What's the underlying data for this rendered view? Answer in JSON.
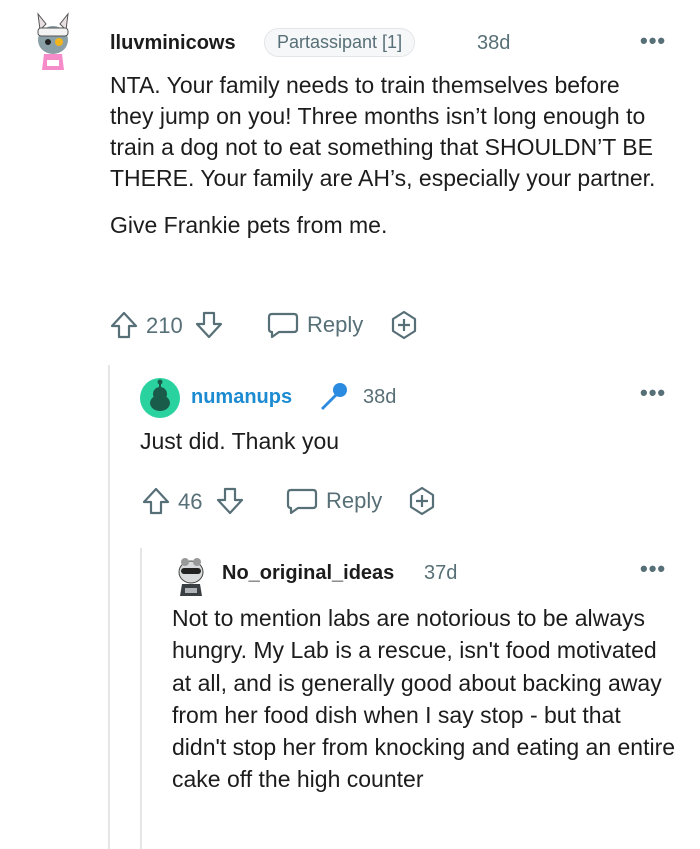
{
  "comments": [
    {
      "username": "lluvminicows",
      "flair": "Partassipant [1]",
      "age": "38d",
      "paragraphs": [
        "NTA. Your family needs to train themselves before they jump on you! Three months isn’t long enough to train a dog not to eat something that SHOULDN’T BE THERE. Your family are AH’s, especially your partner.",
        "Give Frankie pets from me."
      ],
      "score": "210",
      "reply_label": "Reply"
    },
    {
      "username": "numanups",
      "age": "38d",
      "paragraphs": [
        "Just did. Thank you"
      ],
      "score": "46",
      "reply_label": "Reply"
    },
    {
      "username": "No_original_ideas",
      "age": "37d",
      "paragraphs": [
        "Not to mention labs are notorious to be always hungry. My Lab is a rescue, isn't food motivated at all, and is generally good about backing away from her food dish when I say stop - but that didn't stop her from knocking and eating an entire cake off the high counter"
      ]
    }
  ],
  "more_glyph": "•••",
  "colors": {
    "username_op": "#1c1c1c",
    "username_reply": "#1c8bd1",
    "meta": "#576f76",
    "mic": "#2a8be0"
  }
}
